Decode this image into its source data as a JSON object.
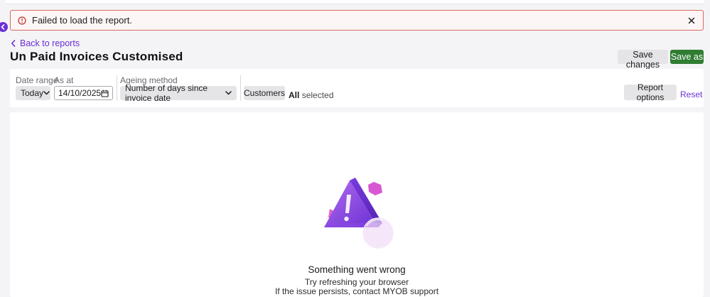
{
  "alert": {
    "message": "Failed to load the report."
  },
  "nav": {
    "back_label": "Back to reports"
  },
  "report": {
    "title": "Un Paid Invoices Customised"
  },
  "actions": {
    "save_changes_label": "Save changes",
    "save_as_label": "Save as"
  },
  "filters": {
    "date_range_label": "Date range",
    "date_range_value": "Today",
    "as_at_label": "As at",
    "as_at_value": "14/10/2025",
    "ageing_label": "Ageing method",
    "ageing_value": "Number of days since invoice date",
    "customers_label": "Customers",
    "customers_selected_strong": "All",
    "customers_selected_rest": "selected",
    "report_options_label": "Report options",
    "reset_label": "Reset"
  },
  "error_state": {
    "title": "Something went wrong",
    "line1": "Try refreshing your browser",
    "line2": "If the issue persists, contact MYOB support"
  },
  "colors": {
    "accent": "#6b2fd6",
    "primary_button": "#2f7d33",
    "alert_border": "#d76a63"
  }
}
